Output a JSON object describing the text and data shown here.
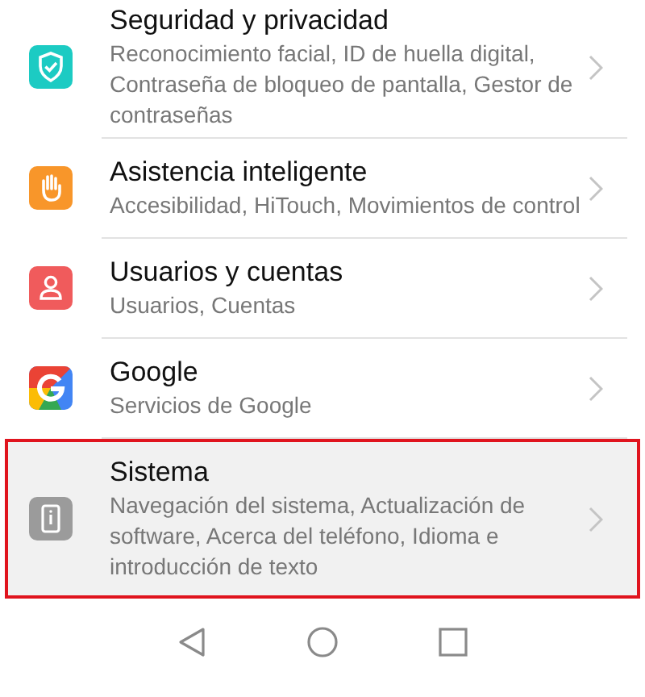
{
  "settings": [
    {
      "title": "Seguridad y privacidad",
      "subtitle": "Reconocimiento facial, ID de huella digital, Contraseña de bloqueo de pantalla, Gestor de contraseñas",
      "selected": false
    },
    {
      "title": "Asistencia inteligente",
      "subtitle": "Accesibilidad, HiTouch, Movimientos de control",
      "selected": false
    },
    {
      "title": "Usuarios y cuentas",
      "subtitle": "Usuarios, Cuentas",
      "selected": false
    },
    {
      "title": "Google",
      "subtitle": "Servicios de Google",
      "selected": false
    },
    {
      "title": "Sistema",
      "subtitle": "Navegación del sistema, Actualización de software, Acerca del teléfono, Idioma e introducción de texto",
      "selected": true
    }
  ]
}
